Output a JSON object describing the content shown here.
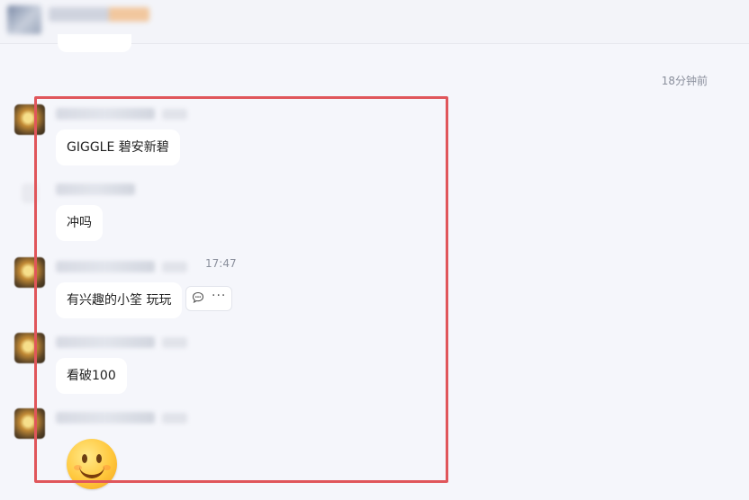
{
  "header": {
    "avatar_icon": "group-avatar-icon",
    "title_blurred": true
  },
  "timeline": {
    "timestamp": "18分钟前"
  },
  "messages": [
    {
      "text": "GIGGLE 碧安新碧",
      "time": ""
    },
    {
      "text": "冲吗",
      "time": ""
    },
    {
      "text": "有兴趣的小筌 玩玩",
      "time": "17:47"
    },
    {
      "text": "看破100",
      "time": ""
    },
    {
      "emoji": "smiley-emoji-icon",
      "time": ""
    }
  ],
  "message_actions": {
    "comment_icon": "comment-icon",
    "more_label": "···"
  },
  "colors": {
    "background": "#f5f6fb",
    "bubble": "#ffffff",
    "highlight_border": "#e0565b",
    "timestamp_text": "#8a8f9c"
  }
}
